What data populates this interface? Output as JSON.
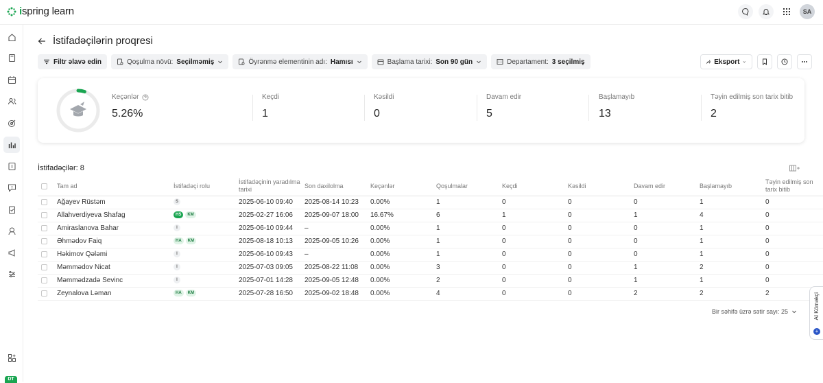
{
  "logo": {
    "bold": "i",
    "text": "spring learn"
  },
  "header": {
    "avatar": "SA"
  },
  "sidebar": {
    "badge": "DT"
  },
  "page": {
    "title": "İstifadəçilərin proqresi"
  },
  "filters": {
    "add": "Filtr əlavə edin",
    "items": [
      {
        "label": "Qoşulma növü:",
        "value": "Seçilməmiş"
      },
      {
        "label": "Öyrənmə elementinin adı:",
        "value": "Hamısı"
      },
      {
        "label": "Başlama tarixi:",
        "value": "Son 90 gün"
      },
      {
        "label": "Departament:",
        "value": "3 seçilmiş"
      }
    ],
    "export": "Eksport"
  },
  "stats": {
    "progress_fraction": 0.0526,
    "items": [
      {
        "label": "Keçənlər",
        "value": "5.26%"
      },
      {
        "label": "Keçdi",
        "value": "1"
      },
      {
        "label": "Kəsildi",
        "value": "0"
      },
      {
        "label": "Davam edir",
        "value": "5"
      },
      {
        "label": "Başlamayıb",
        "value": "13"
      },
      {
        "label": "Təyin edilmiş son tarix bitib",
        "value": "2"
      }
    ]
  },
  "users": {
    "count_label": "İstifadəçilər: 8"
  },
  "table": {
    "headers": [
      "Tam ad",
      "İstifadəçi rolu",
      "İstifadəçinin yaradılma tarixi",
      "Son daxilolma",
      "Keçənlər",
      "Qoşulmalar",
      "Keçdi",
      "Kəsildi",
      "Davam edir",
      "Başlamayıb",
      "Təyin edilmiş son tarix bitib"
    ],
    "rows": [
      {
        "name": "Ağayev Rüstəm",
        "roles": [
          "S"
        ],
        "created": "2025-06-10 09:40",
        "last": "2025-08-14 10:23",
        "pass": "0.00%",
        "enroll": "1",
        "passed": "0",
        "fail": "0",
        "progress": "0",
        "notstarted": "1",
        "overdue": "0"
      },
      {
        "name": "Allahverdiyeva Shafag",
        "roles": [
          "HS",
          "KM"
        ],
        "created": "2025-02-27 16:06",
        "last": "2025-09-07 18:00",
        "pass": "16.67%",
        "enroll": "6",
        "passed": "1",
        "fail": "0",
        "progress": "1",
        "notstarted": "4",
        "overdue": "0"
      },
      {
        "name": "Amiraslanova Bahar",
        "roles": [
          "I"
        ],
        "created": "2025-06-10 09:44",
        "last": "–",
        "pass": "0.00%",
        "enroll": "1",
        "passed": "0",
        "fail": "0",
        "progress": "0",
        "notstarted": "1",
        "overdue": "0"
      },
      {
        "name": "Əhmədov Faiq",
        "roles": [
          "HA",
          "KM"
        ],
        "created": "2025-08-18 10:13",
        "last": "2025-09-05 10:26",
        "pass": "0.00%",
        "enroll": "1",
        "passed": "0",
        "fail": "0",
        "progress": "0",
        "notstarted": "1",
        "overdue": "0"
      },
      {
        "name": "Həkimov Qələmi",
        "roles": [
          "I"
        ],
        "created": "2025-06-10 09:43",
        "last": "–",
        "pass": "0.00%",
        "enroll": "1",
        "passed": "0",
        "fail": "0",
        "progress": "0",
        "notstarted": "1",
        "overdue": "0"
      },
      {
        "name": "Məmmədov Nicat",
        "roles": [
          "I"
        ],
        "created": "2025-07-03 09:05",
        "last": "2025-08-22 11:08",
        "pass": "0.00%",
        "enroll": "3",
        "passed": "0",
        "fail": "0",
        "progress": "1",
        "notstarted": "2",
        "overdue": "0"
      },
      {
        "name": "Məmmədzadə Sevinc",
        "roles": [
          "I"
        ],
        "created": "2025-07-01 14:28",
        "last": "2025-09-05 12:48",
        "pass": "0.00%",
        "enroll": "2",
        "passed": "0",
        "fail": "0",
        "progress": "1",
        "notstarted": "1",
        "overdue": "0"
      },
      {
        "name": "Zeynalova Ləman",
        "roles": [
          "HA",
          "KM"
        ],
        "created": "2025-07-28 16:50",
        "last": "2025-09-02 18:48",
        "pass": "0.00%",
        "enroll": "4",
        "passed": "0",
        "fail": "0",
        "progress": "2",
        "notstarted": "2",
        "overdue": "2"
      }
    ]
  },
  "pager": {
    "label": "Bir səhifə üzrə sətir sayı: 25"
  },
  "ai": {
    "label": "AI Köməkçi"
  }
}
